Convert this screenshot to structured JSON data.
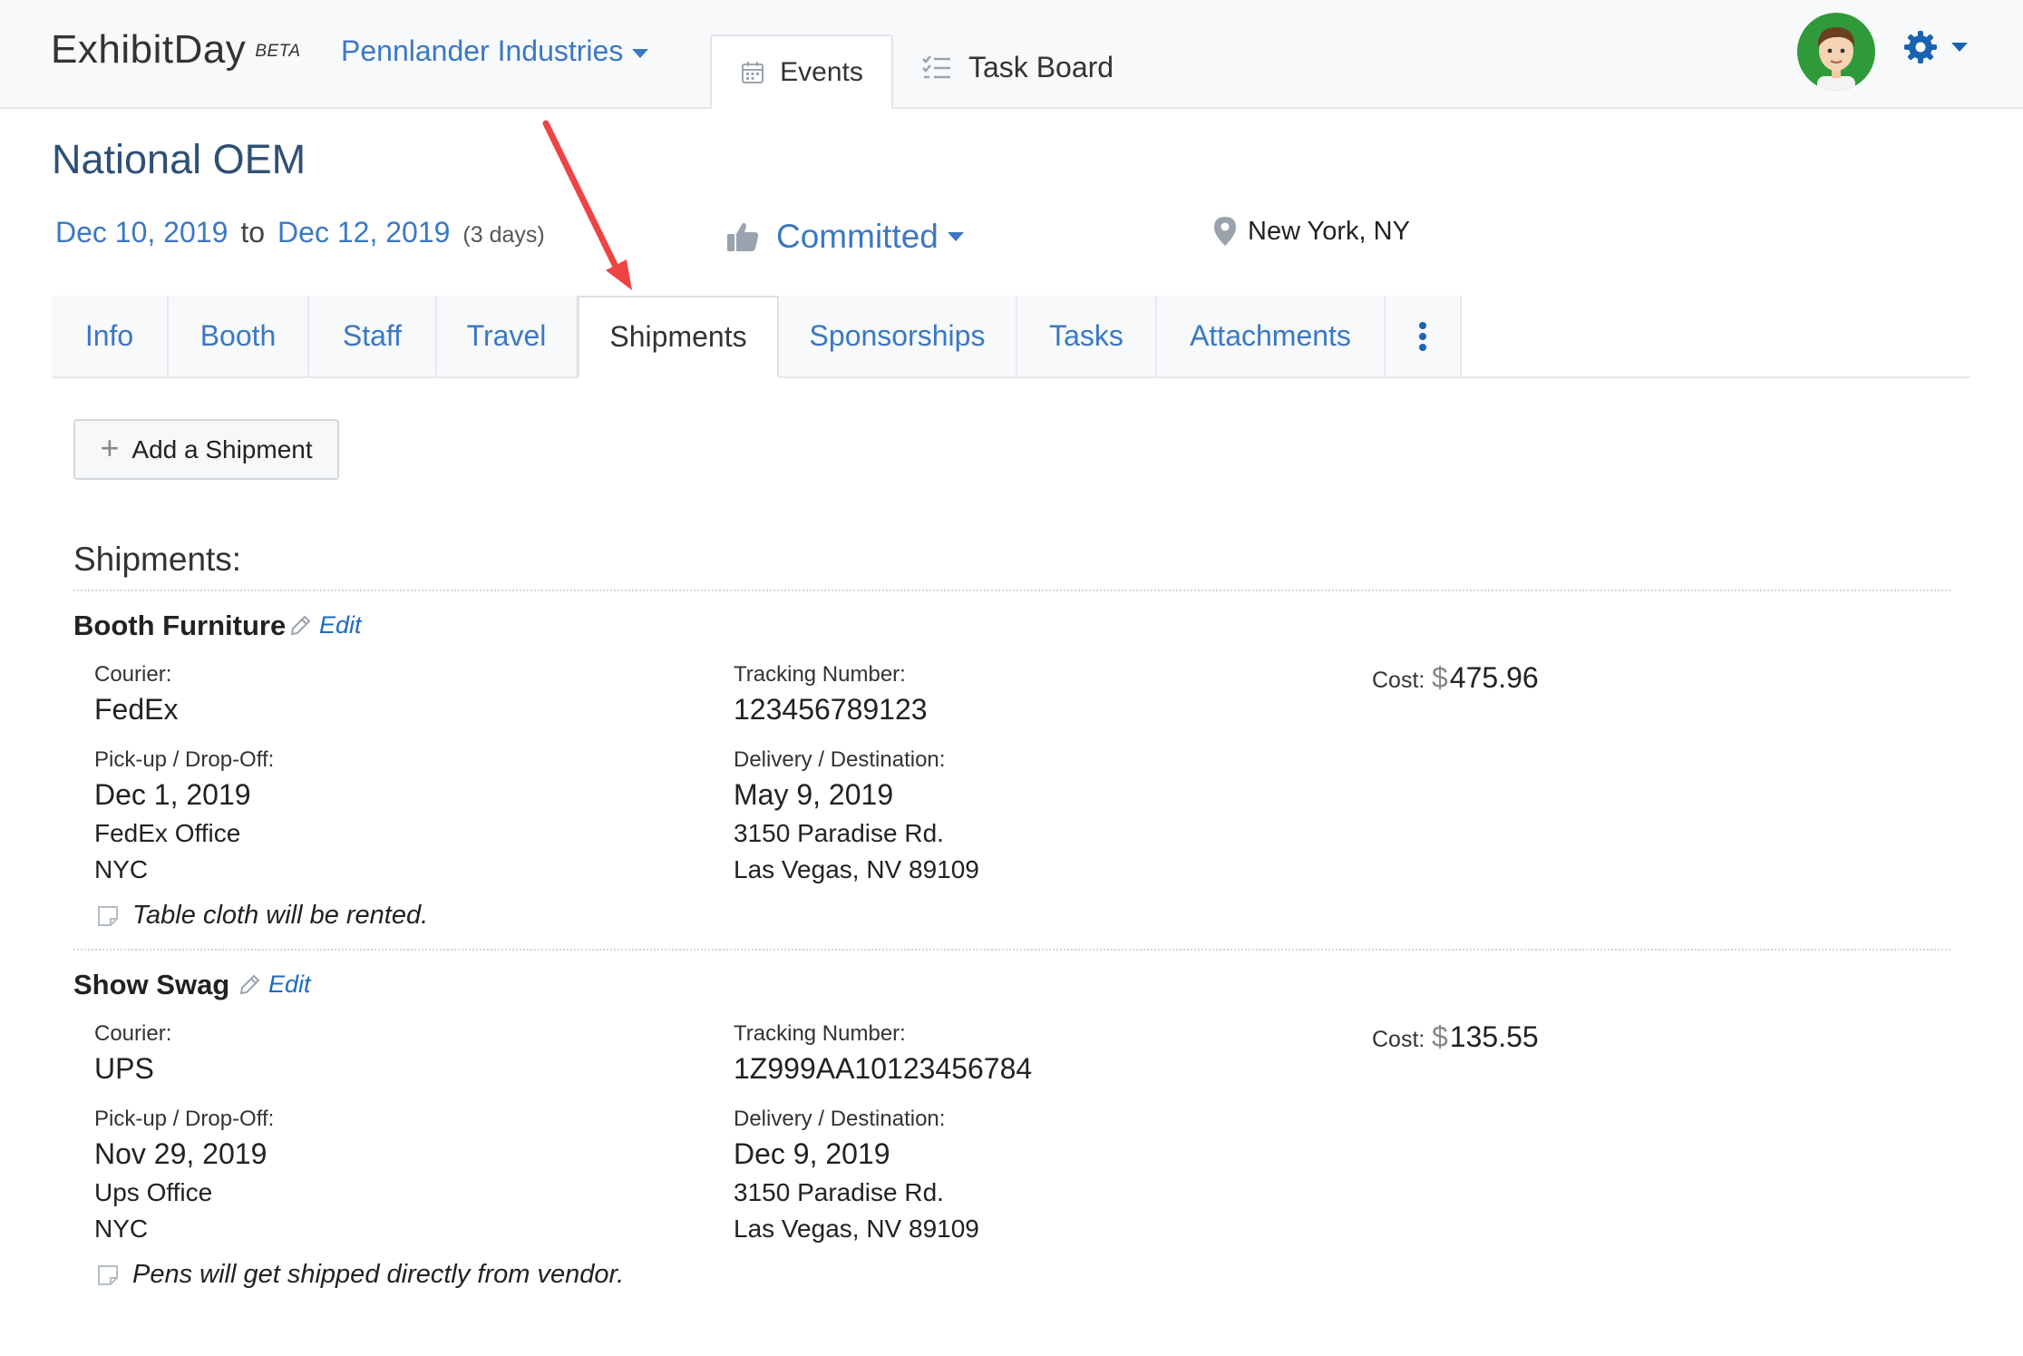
{
  "header": {
    "logo": "ExhibitDay",
    "logo_badge": "BETA",
    "org_name": "Pennlander Industries",
    "nav": {
      "events": "Events",
      "task_board": "Task Board"
    }
  },
  "event": {
    "title": "National OEM",
    "start_date": "Dec 10, 2019",
    "to_label": "to",
    "end_date": "Dec 12, 2019",
    "duration": "(3 days)",
    "status": "Committed",
    "location": "New York, NY"
  },
  "tabs": [
    {
      "label": "Info"
    },
    {
      "label": "Booth"
    },
    {
      "label": "Staff"
    },
    {
      "label": "Travel"
    },
    {
      "label": "Shipments",
      "active": true
    },
    {
      "label": "Sponsorships"
    },
    {
      "label": "Tasks"
    },
    {
      "label": "Attachments"
    }
  ],
  "add_button": "Add a Shipment",
  "section_heading": "Shipments:",
  "labels": {
    "edit": "Edit",
    "courier": "Courier:",
    "tracking": "Tracking Number:",
    "pickup": "Pick-up / Drop-Off:",
    "delivery": "Delivery / Destination:",
    "cost": "Cost:",
    "currency": "$"
  },
  "shipments": [
    {
      "name": "Booth Furniture",
      "courier": "FedEx",
      "tracking": "123456789123",
      "cost": "475.96",
      "pickup_date": "Dec 1, 2019",
      "pickup_line1": "FedEx Office",
      "pickup_line2": "NYC",
      "delivery_date": "May 9, 2019",
      "delivery_line1": "3150 Paradise Rd.",
      "delivery_line2": "Las Vegas, NV 89109",
      "note": "Table cloth will be rented."
    },
    {
      "name": "Show Swag",
      "courier": "UPS",
      "tracking": "1Z999AA10123456784",
      "cost": "135.55",
      "pickup_date": "Nov 29, 2019",
      "pickup_line1": "Ups Office",
      "pickup_line2": "NYC",
      "delivery_date": "Dec 9, 2019",
      "delivery_line1": "3150 Paradise Rd.",
      "delivery_line2": "Las Vegas, NV 89109",
      "note": "Pens will get shipped directly from vendor."
    }
  ],
  "colors": {
    "link": "#3b78c3",
    "annotation_arrow": "#ee4444"
  }
}
